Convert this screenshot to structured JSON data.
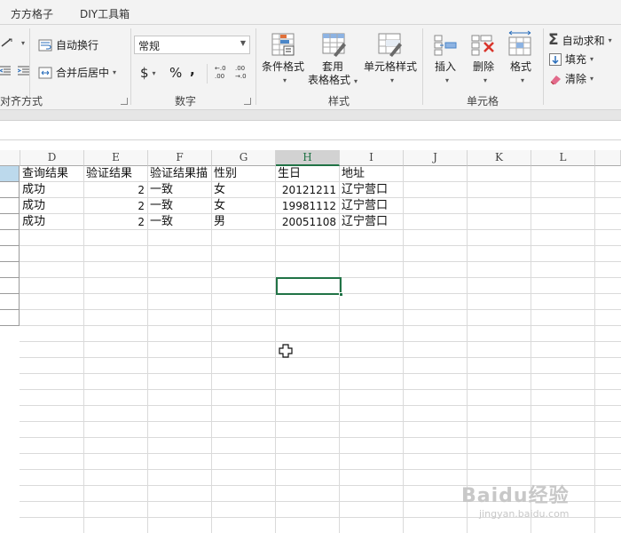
{
  "tabs": [
    "方方格子",
    "DIY工具箱"
  ],
  "ribbon": {
    "alignment": {
      "wrap_text": "自动换行",
      "merge_center": "合并后居中",
      "group_label": "对齐方式"
    },
    "number": {
      "format_value": "常规",
      "currency": "$",
      "percent": "%",
      "comma": ",",
      "inc_decimal": "←.0\n.00",
      "dec_decimal": ".00\n→.0",
      "group_label": "数字"
    },
    "styles": {
      "conditional": "条件格式",
      "table_format_1": "套用",
      "table_format_2": "表格格式",
      "cell_styles": "单元格样式",
      "group_label": "样式"
    },
    "cells": {
      "insert": "插入",
      "delete": "删除",
      "format": "格式",
      "group_label": "单元格"
    },
    "editing": {
      "autosum": "自动求和",
      "fill": "填充",
      "clear": "清除"
    }
  },
  "columns": [
    "D",
    "E",
    "F",
    "G",
    "H",
    "I",
    "J",
    "K",
    "L"
  ],
  "selected_column": "H",
  "rows": [
    [
      "查询结果",
      "验证结果",
      "验证结果描",
      "性别",
      "生日",
      "地址"
    ],
    [
      "成功",
      "2",
      "一致",
      "女",
      "20121211",
      "辽宁营口"
    ],
    [
      "成功",
      "2",
      "一致",
      "女",
      "19981112",
      "辽宁营口"
    ],
    [
      "成功",
      "2",
      "一致",
      "男",
      "20051108",
      "辽宁营口"
    ]
  ],
  "watermark": {
    "brand": "Baidu经验",
    "url": "jingyan.baidu.com"
  }
}
